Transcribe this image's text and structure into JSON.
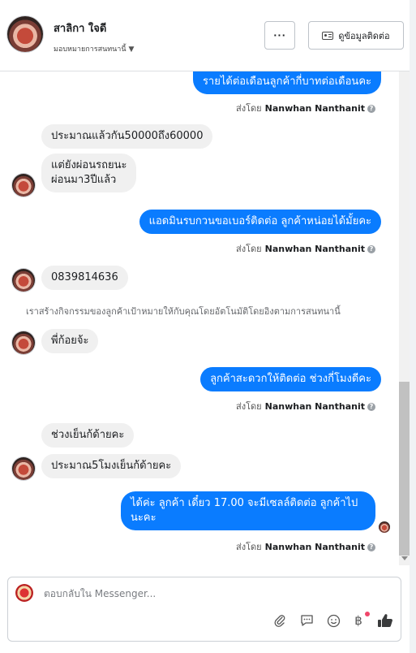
{
  "header": {
    "contact_name": "สาลิกา ใจดี",
    "assign_label": "มอบหมายการสนทนานี้",
    "more_label": "···",
    "contact_info_label": "ดูข้อมูลติดต่อ"
  },
  "messages": [
    {
      "direction": "out",
      "text": "รายได้ต่อเดือนลูกค้ากี่บาทต่อเดือนคะ"
    },
    {
      "direction": "in",
      "text": "ประมาณแล้วกัน50000ถึง60000"
    },
    {
      "direction": "in",
      "text_lines": [
        "แต่ยังผ่อนรถยนะ",
        "ผ่อนมา3ปีแล้ว"
      ]
    },
    {
      "direction": "out",
      "text": "แอดมินรบกวนขอเบอร์ติดต่อ ลูกค้าหน่อยได้มั้ยคะ"
    },
    {
      "direction": "in",
      "text": "0839814636"
    },
    {
      "direction": "in",
      "text": "พี่ก้อยจ้ะ"
    },
    {
      "direction": "out",
      "text": "ลูกค้าสะดวกให้ติดต่อ ช่วงกี่โมงดีคะ"
    },
    {
      "direction": "in",
      "text": "ช่วงเย็นก้ด้ายคะ"
    },
    {
      "direction": "in",
      "text": "ประมาณ5โมงเย็นก้ด้ายคะ"
    },
    {
      "direction": "out",
      "text_lines": [
        "ได้ค่ะ ลูกค้า เดี๋ยว 17.00 จะมีเซลล์ติดต่อ ลูกค้าไป",
        "นะคะ"
      ]
    }
  ],
  "sender": {
    "prefix": "ส่งโดย",
    "name": "Nanwhan Nanthanit"
  },
  "system_note": "เราสร้างกิจกรรมของลูกค้าเป้าหมายให้กับคุณโดยอัตโนมัติโดยอิงตามการสนทนานี้",
  "composer": {
    "placeholder": "ตอบกลับใน Messenger..."
  },
  "icons": [
    "paperclip-icon",
    "speech-bubble-icon",
    "smiley-icon",
    "baht-icon",
    "thumbs-up-icon"
  ],
  "colors": {
    "outgoing_bubble": "#0a7cff",
    "incoming_bubble": "#f0f0f0",
    "notification_dot": "#f0466a"
  }
}
